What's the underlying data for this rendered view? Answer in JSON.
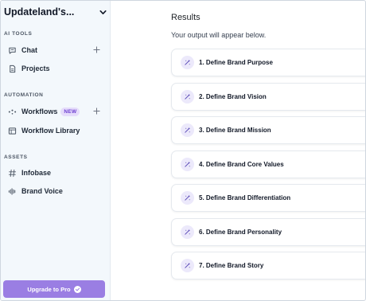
{
  "sidebar": {
    "workspace_title": "Updateland's...",
    "sections": {
      "ai_tools": "AI TOOLS",
      "automation": "AUTOMATION",
      "assets": "ASSETS"
    },
    "items": {
      "chat": "Chat",
      "projects": "Projects",
      "workflows": "Workflows",
      "workflows_badge": "NEW",
      "workflow_library": "Workflow Library",
      "infobase": "Infobase",
      "brand_voice": "Brand Voice"
    },
    "upgrade_label": "Upgrade to Pro"
  },
  "main": {
    "title": "Results",
    "subtitle": "Your output will appear below.",
    "steps": [
      "1. Define Brand Purpose",
      "2. Define Brand Vision",
      "3. Define Brand Mission",
      "4. Define Brand Core Values",
      "5. Define Brand Differentiation",
      "6. Define Brand Personality",
      "7. Define Brand Story"
    ]
  },
  "colors": {
    "sidebar_bg": "#f3f8fc",
    "accent": "#9a7ee3",
    "badge_bg": "#e5dcfb",
    "badge_text": "#6d3fd1",
    "step_icon_bg": "#ece9fb"
  },
  "icons": {
    "chevron": "chevron-down-icon",
    "chat": "chat-bubble-icon",
    "projects": "document-icon",
    "workflows": "workflow-dots-icon",
    "workflow_library": "library-panel-icon",
    "infobase": "hash-icon",
    "brand_voice": "sound-wave-icon",
    "step": "wand-sparkle-icon",
    "add": "plus-icon",
    "upgrade": "check-circle-icon"
  }
}
